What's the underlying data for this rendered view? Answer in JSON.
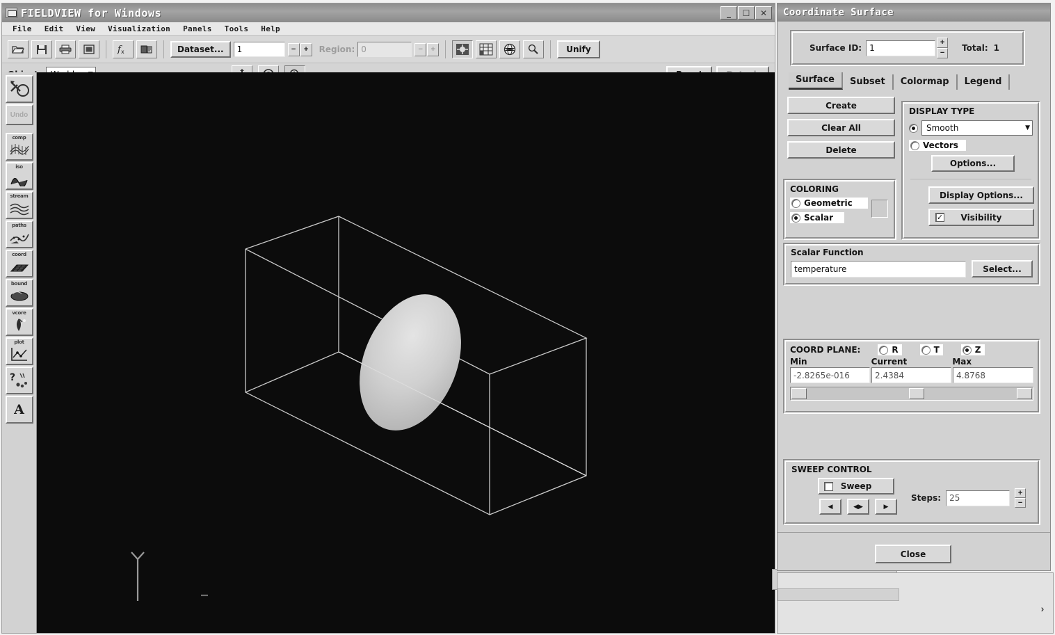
{
  "app": {
    "title": "FIELDVIEW for Windows",
    "window_icon": "fieldview-app-icon",
    "window_buttons": [
      {
        "name": "minimize-button",
        "glyph": "_"
      },
      {
        "name": "maximize-button",
        "glyph": "❐"
      },
      {
        "name": "close-button",
        "glyph": "✕"
      }
    ],
    "menus": [
      "File",
      "Edit",
      "View",
      "Visualization",
      "Panels",
      "Tools",
      "Help"
    ],
    "toolbar": {
      "buttons": [
        {
          "name": "open-file-icon",
          "glyph": "὜1"
        },
        {
          "name": "save-file-icon",
          "glyph": "ὋE"
        },
        {
          "name": "print-icon",
          "glyph": "⎙"
        },
        {
          "name": "restart-icon",
          "glyph": "▣"
        }
      ],
      "function_icon": "fx-function-icon",
      "transform_icon": "transform-icon",
      "dataset_label": "Dataset...",
      "dataset_value": "1",
      "region_label": "Region:",
      "region_value": "0",
      "view_icons": [
        {
          "name": "center-view-icon"
        },
        {
          "name": "grid-view-icon"
        },
        {
          "name": "globe-view-icon"
        },
        {
          "name": "zoom-probe-icon"
        }
      ],
      "unify_label": "Unify"
    },
    "toolbar2": {
      "object_label": "Object:",
      "object_value": "World",
      "mode_icons": [
        {
          "name": "pan-tool-icon",
          "glyph": "✥"
        },
        {
          "name": "rotate-tool-icon",
          "glyph": "◎"
        },
        {
          "name": "zoom-tool-icon",
          "glyph": "❂"
        }
      ],
      "reset_label": "Reset",
      "detach_label": "Detach"
    },
    "sidebar": [
      {
        "name": "sidebar-item-transform",
        "caption": "",
        "glyph": "⧉",
        "disabled": false
      },
      {
        "name": "sidebar-item-undo",
        "caption": "Undo",
        "glyph": "",
        "disabled": true
      },
      {
        "name": "sidebar-item-computational-surface",
        "caption": "comp",
        "glyph": "▓",
        "disabled": false
      },
      {
        "name": "sidebar-item-iso-surface",
        "caption": "iso",
        "glyph": "◑",
        "disabled": false
      },
      {
        "name": "sidebar-item-streamlines",
        "caption": "stream",
        "glyph": "≋",
        "disabled": false
      },
      {
        "name": "sidebar-item-particle-paths",
        "caption": "paths",
        "glyph": "☁",
        "disabled": false
      },
      {
        "name": "sidebar-item-coordinate-surface",
        "caption": "coord",
        "glyph": "▦",
        "disabled": false
      },
      {
        "name": "sidebar-item-boundary-surface",
        "caption": "bound",
        "glyph": "⬬",
        "disabled": false
      },
      {
        "name": "sidebar-item-vortex-cores",
        "caption": "vcore",
        "glyph": "✻",
        "disabled": false
      },
      {
        "name": "sidebar-item-xy-plot",
        "caption": "plot",
        "glyph": "⧐",
        "disabled": false
      },
      {
        "name": "sidebar-item-query-probe",
        "caption": "?",
        "glyph": "∴",
        "disabled": false
      },
      {
        "name": "sidebar-item-annotation-text",
        "caption": "",
        "glyph": "A",
        "disabled": false
      }
    ]
  },
  "viewport": {
    "name": "3d-viewport",
    "background_color": "#0c0c0c",
    "wireframe_color": "#d8d8d8",
    "surface_color": "#c9c9c9",
    "axis_triad_label": "axis-triad"
  },
  "dialog": {
    "title": "Coordinate Surface",
    "surface_id_label": "Surface ID:",
    "surface_id_value": "1",
    "total_label": "Total:",
    "total_value": "1",
    "tabs": [
      {
        "label": "Surface",
        "active": true
      },
      {
        "label": "Subset",
        "active": false
      },
      {
        "label": "Colormap",
        "active": false
      },
      {
        "label": "Legend",
        "active": false
      }
    ],
    "actions": {
      "create": "Create",
      "clear_all": "Clear All",
      "delete": "Delete"
    },
    "coloring": {
      "title": "COLORING",
      "geometric_label": "Geometric",
      "scalar_label": "Scalar",
      "selected": "Scalar",
      "swatch_color": "#cccccc"
    },
    "display_type": {
      "title": "DISPLAY TYPE",
      "smooth_label": "Smooth",
      "vectors_label": "Vectors",
      "selected": "Smooth",
      "options_label": "Options...",
      "display_options_label": "Display Options...",
      "visibility_label": "Visibility",
      "visibility_checked": true,
      "check_glyph": "✓"
    },
    "scalar_function": {
      "title": "Scalar Function",
      "value": "temperature",
      "select_label": "Select..."
    },
    "coord_plane": {
      "title": "COORD PLANE:",
      "options": [
        {
          "label": "R",
          "selected": false
        },
        {
          "label": "T",
          "selected": false
        },
        {
          "label": "Z",
          "selected": true
        }
      ],
      "min_label": "Min",
      "current_label": "Current",
      "max_label": "Max",
      "min_value": "-2.8265e-016",
      "current_value": "2.4384",
      "max_value": "4.8768",
      "slider_percent": 50
    },
    "sweep_control": {
      "title": "SWEEP CONTROL",
      "sweep_label": "Sweep",
      "sweep_checked": false,
      "back_glyph": "◀",
      "both_glyph": "◀▶",
      "forward_glyph": "▶",
      "steps_label": "Steps:",
      "steps_value": "25"
    },
    "close_label": "Close"
  },
  "background_window": {
    "vectors_label": "Vectors",
    "scroll_arrow_glyph": "›"
  }
}
